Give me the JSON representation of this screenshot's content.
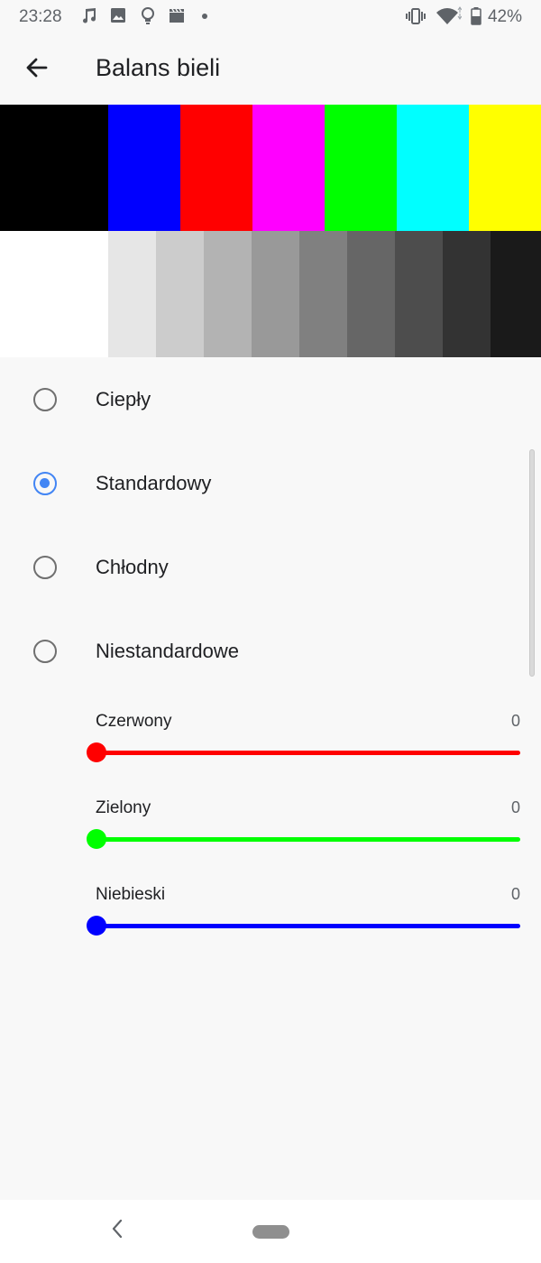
{
  "status_bar": {
    "time": "23:28",
    "battery_percent": "42%",
    "notification_icons": [
      "music-note-icon",
      "image-icon",
      "lightbulb-icon",
      "clapperboard-icon",
      "dot-icon"
    ],
    "system_icons": [
      "vibrate-icon",
      "wifi-icon",
      "battery-icon"
    ]
  },
  "app_bar": {
    "title": "Balans bieli",
    "back_icon": "arrow-left-icon"
  },
  "color_bars": {
    "top_row": [
      "#000000",
      "#0000ff",
      "#ff0000",
      "#ff00ff",
      "#00ff00",
      "#00ffff",
      "#ffff00"
    ],
    "bottom_row": [
      "#ffffff",
      "#e6e6e6",
      "#cccccc",
      "#b3b3b3",
      "#999999",
      "#808080",
      "#666666",
      "#4d4d4d",
      "#333333",
      "#1a1a1a"
    ]
  },
  "options": [
    {
      "label": "Ciepły",
      "selected": false
    },
    {
      "label": "Standardowy",
      "selected": true
    },
    {
      "label": "Chłodny",
      "selected": false
    },
    {
      "label": "Niestandardowe",
      "selected": false
    }
  ],
  "sliders": [
    {
      "label": "Czerwony",
      "value": "0",
      "color": "#ff0000"
    },
    {
      "label": "Zielony",
      "value": "0",
      "color": "#00ff00"
    },
    {
      "label": "Niebieski",
      "value": "0",
      "color": "#0000ff"
    }
  ],
  "colors": {
    "accent": "#4285f4",
    "background": "#f8f8f8"
  },
  "nav_bar": {
    "back_icon": "chevron-left-icon",
    "home_icon": "home-pill-icon"
  }
}
